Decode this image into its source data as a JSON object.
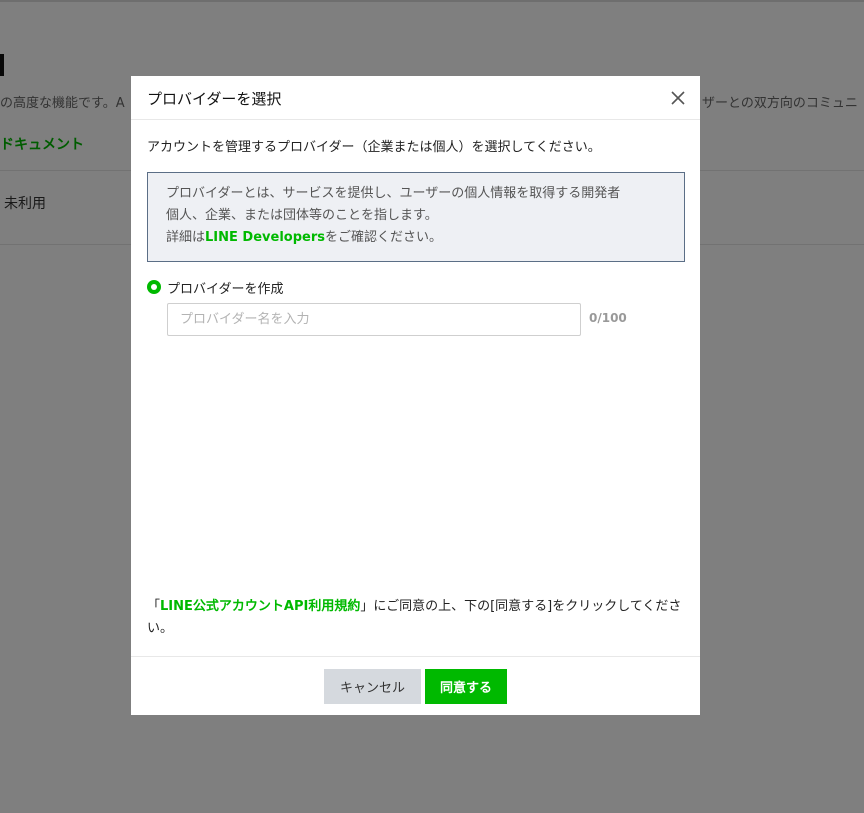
{
  "background": {
    "desc_left": "の高度な機能です。A",
    "desc_right": "ザーとの双方向のコミュニ",
    "doc_link": "ドキュメント",
    "status": "未利用"
  },
  "modal": {
    "title": "プロバイダーを選択",
    "intro": "アカウントを管理するプロバイダー（企業または個人）を選択してください。",
    "info": {
      "line1": "プロバイダーとは、サービスを提供し、ユーザーの個人情報を取得する開発者",
      "line2": "個人、企業、または団体等のことを指します。",
      "line3_prefix": "詳細は",
      "line3_link": "LINE Developers",
      "line3_suffix": "をご確認ください。"
    },
    "radio_label": "プロバイダーを作成",
    "input_placeholder": "プロバイダー名を入力",
    "input_value": "",
    "counter": "0/100",
    "terms": {
      "open_bracket": "「",
      "link": "LINE公式アカウントAPI利用規約",
      "text": "」にご同意の上、下の[同意する]をクリックしてください。"
    },
    "cancel_label": "キャンセル",
    "agree_label": "同意する"
  },
  "colors": {
    "accent": "#00b900",
    "overlay": "rgba(0,0,0,0.5)"
  }
}
